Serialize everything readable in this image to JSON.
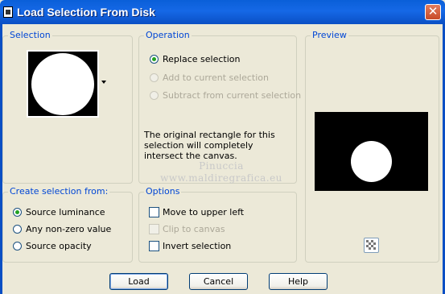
{
  "window": {
    "title": "Load Selection From Disk",
    "close_glyph": "✕"
  },
  "selection": {
    "group_label": "Selection"
  },
  "operation": {
    "group_label": "Operation",
    "options": [
      {
        "label": "Replace selection",
        "checked": true,
        "enabled": true
      },
      {
        "label": "Add to current selection",
        "checked": false,
        "enabled": false
      },
      {
        "label": "Subtract from current selection",
        "checked": false,
        "enabled": false
      }
    ],
    "description": "The original rectangle for this selection will completely intersect the canvas."
  },
  "preview": {
    "group_label": "Preview"
  },
  "create_from": {
    "group_label": "Create selection from:",
    "options": [
      {
        "label": "Source luminance",
        "checked": true
      },
      {
        "label": "Any non-zero value",
        "checked": false
      },
      {
        "label": "Source opacity",
        "checked": false
      }
    ]
  },
  "options": {
    "group_label": "Options",
    "items": [
      {
        "label": "Move to upper left",
        "checked": false,
        "enabled": true
      },
      {
        "label": "Clip to canvas",
        "checked": false,
        "enabled": false
      },
      {
        "label": "Invert selection",
        "checked": false,
        "enabled": true
      }
    ]
  },
  "watermark": {
    "line1": "Pinuccia",
    "line2": "www.maldiregrafica.eu"
  },
  "buttons": {
    "load": "Load",
    "cancel": "Cancel",
    "help": "Help"
  }
}
